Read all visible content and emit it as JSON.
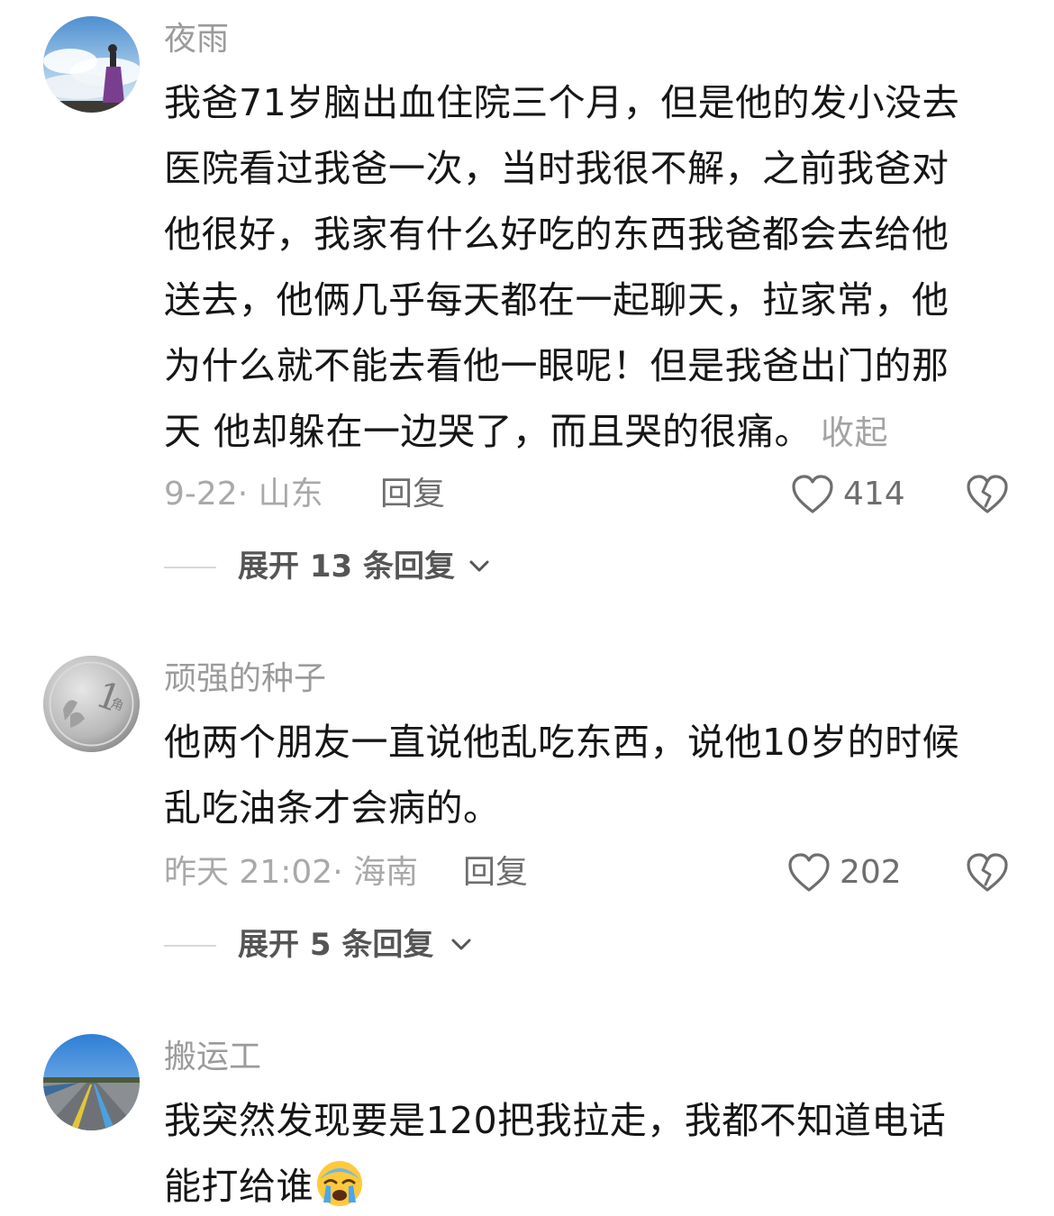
{
  "comments": [
    {
      "username": "夜雨",
      "avatar_icon": "avatar-sky-figure",
      "lines": [
        "我爸71岁脑出血住院三个月，但是他的发小没去",
        "医院看过我爸一次，当时我很不解，之前我爸对",
        "他很好，我家有什么好吃的东西我爸都会去给他",
        "送去，他俩几乎每天都在一起聊天，拉家常，他",
        "为什么就不能去看他一眼呢！但是我爸出门的那",
        "天 他却躲在一边哭了，而且哭的很痛。"
      ],
      "collapse_label": "收起",
      "time_location": "9-22· 山东",
      "reply_label": "回复",
      "like_count": "414",
      "expand_label": "展开 13 条回复"
    },
    {
      "username": "顽强的种子",
      "avatar_icon": "avatar-coin",
      "lines": [
        "他两个朋友一直说他乱吃东西，说他10岁的时候",
        "乱吃油条才会病的。"
      ],
      "time_location": "昨天 21:02· 海南",
      "reply_label": "回复",
      "like_count": "202",
      "expand_label": "展开 5 条回复"
    },
    {
      "username": "搬运工",
      "avatar_icon": "avatar-road",
      "lines": [
        "我突然发现要是120把我拉走，我都不知道电话",
        "能打给谁"
      ],
      "emoji_icon": "crying-face-icon"
    }
  ],
  "colors": {
    "text_primary": "#161616",
    "text_secondary": "#9b9b9b",
    "background": "#ffffff"
  }
}
